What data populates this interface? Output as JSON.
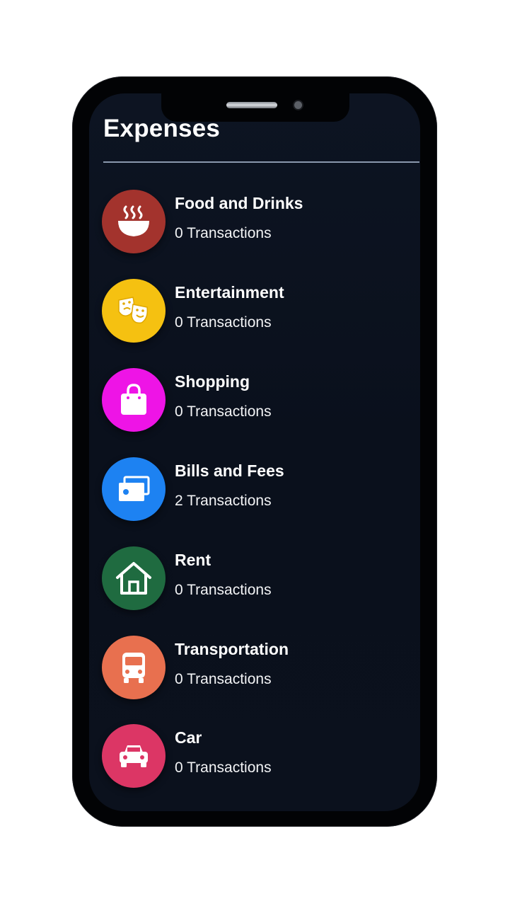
{
  "page": {
    "title": "Expenses"
  },
  "categories": [
    {
      "name": "Food and Drinks",
      "transactions": "0 Transactions",
      "icon": "bowl-icon",
      "color": "#a3332d"
    },
    {
      "name": "Entertainment",
      "transactions": "0 Transactions",
      "icon": "theater-masks-icon",
      "color": "#f5c111"
    },
    {
      "name": "Shopping",
      "transactions": "0 Transactions",
      "icon": "shopping-bag-icon",
      "color": "#ee14e6"
    },
    {
      "name": "Bills and Fees",
      "transactions": "2 Transactions",
      "icon": "money-bills-icon",
      "color": "#1d82f2"
    },
    {
      "name": "Rent",
      "transactions": "0 Transactions",
      "icon": "house-icon",
      "color": "#1f6b40"
    },
    {
      "name": "Transportation",
      "transactions": "0 Transactions",
      "icon": "bus-icon",
      "color": "#e8704f"
    },
    {
      "name": "Car",
      "transactions": "0 Transactions",
      "icon": "car-icon",
      "color": "#dc3665"
    }
  ]
}
